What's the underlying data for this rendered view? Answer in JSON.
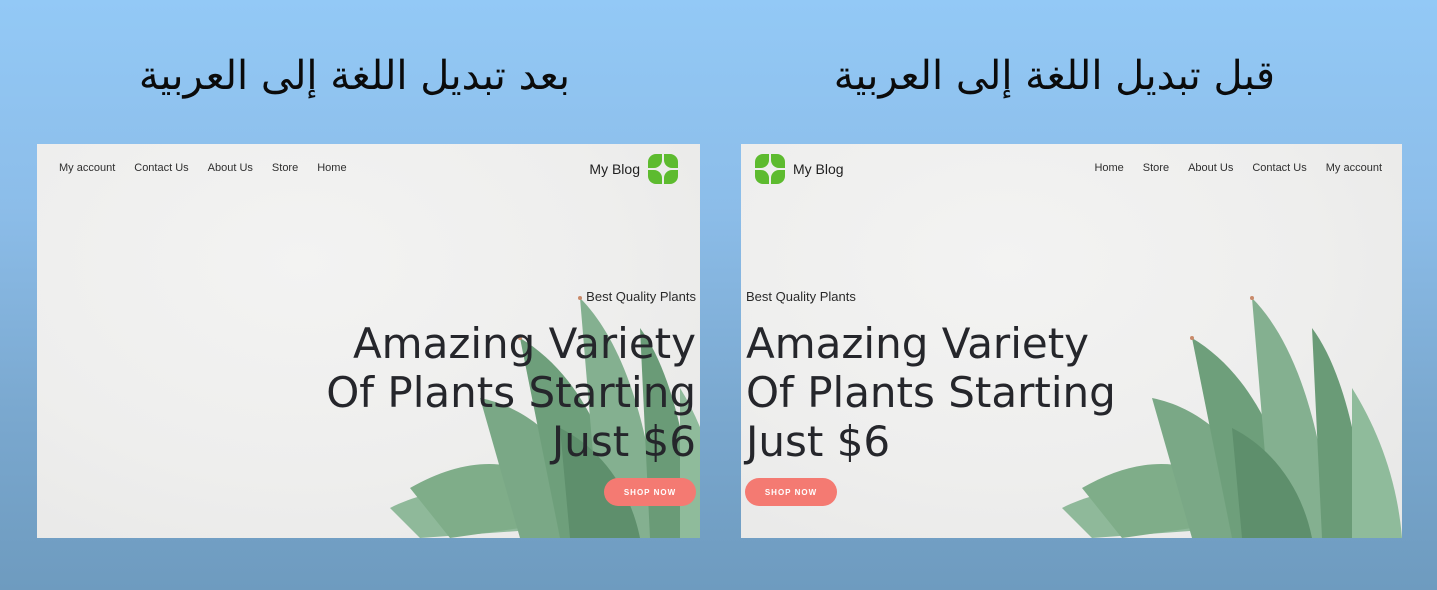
{
  "captions": {
    "after": "بعد تبديل اللغة إلى العربية",
    "before": "قبل تبديل اللغة إلى العربية"
  },
  "site": {
    "brand": "My Blog",
    "nav": {
      "home": "Home",
      "store": "Store",
      "about": "About Us",
      "contact": "Contact Us",
      "account": "My account"
    },
    "hero": {
      "subtitle": "Best Quality Plants",
      "line1": "Amazing Variety",
      "line2": "Of Plants Starting",
      "line3": "Just $6",
      "cta": "SHOP NOW"
    }
  },
  "colors": {
    "logo_green": "#5dbb2f",
    "cta": "#f47a72",
    "heading": "#25262b",
    "background_top": "#93c9f6",
    "background_bottom": "#6e9bbf"
  },
  "icons": {
    "logo": "green-four-leaf-logo-icon",
    "plant": "succulent-plant-image"
  }
}
